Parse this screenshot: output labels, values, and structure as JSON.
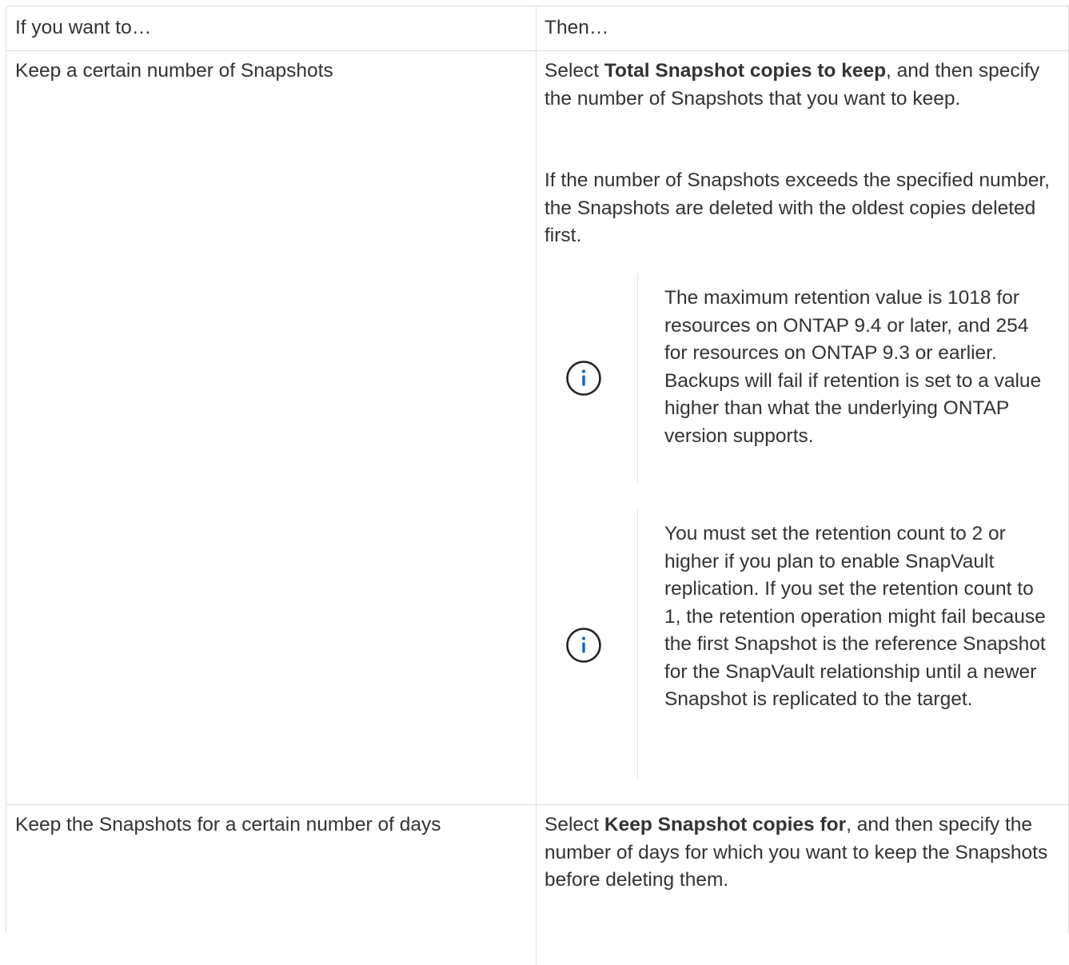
{
  "table": {
    "header": {
      "col1": "If you want to…",
      "col2": "Then…"
    },
    "rows": [
      {
        "want": "Keep a certain number of Snapshots",
        "then_prefix": "Select ",
        "then_bold": "Total Snapshot copies to keep",
        "then_suffix": ", and then specify the number of Snapshots that you want to keep.",
        "paragraph2": "If the number of Snapshots exceeds the specified number, the Snapshots are deleted with the oldest copies deleted first.",
        "notes": [
          {
            "icon": "info-icon",
            "text": "The maximum retention value is 1018 for resources on ONTAP 9.4 or later, and 254 for resources on ONTAP 9.3 or earlier. Backups will fail if retention is set to a value higher than what the underlying ONTAP version supports."
          },
          {
            "icon": "info-icon",
            "text": "You must set the retention count to 2 or higher if you plan to enable SnapVault replication. If you set the retention count to 1, the retention operation might fail because the first Snapshot is the reference Snapshot for the SnapVault relationship until a newer Snapshot is replicated to the target."
          }
        ]
      },
      {
        "want": "Keep the Snapshots for a certain number of days",
        "then_prefix": "Select ",
        "then_bold": "Keep Snapshot copies for",
        "then_suffix": ", and then specify the number of days for which you want to keep the Snapshots before deleting them."
      }
    ]
  },
  "colors": {
    "text": "#333333",
    "border": "#dedede",
    "info_icon": "#1565c0"
  }
}
